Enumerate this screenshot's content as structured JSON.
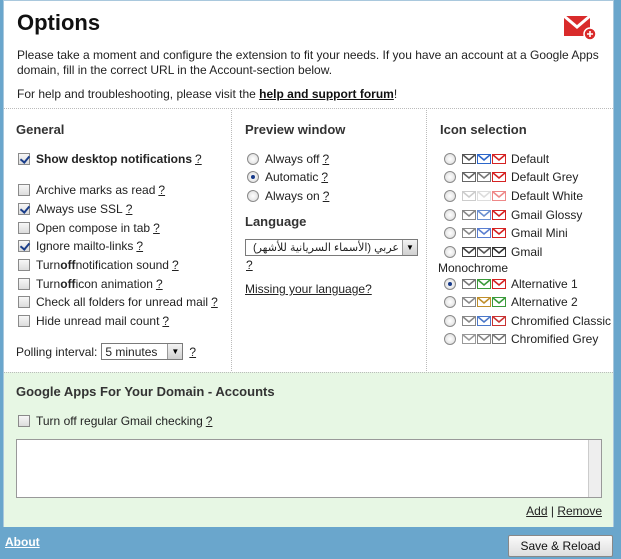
{
  "header": {
    "title": "Options",
    "intro": "Please take a moment and configure the extension to fit your needs. If you have an account at a Google Apps domain, fill in the correct URL in the Account-section below.",
    "help_prefix": "For help and troubleshooting, please visit the ",
    "help_link": "help and support forum",
    "help_suffix": "!"
  },
  "general": {
    "heading": "General",
    "options": [
      {
        "label": "Show desktop notifications",
        "checked": true,
        "bold": true
      },
      {
        "label": "Archive marks as read",
        "checked": false
      },
      {
        "label": "Always use SSL",
        "checked": true
      },
      {
        "label": "Open compose in tab",
        "checked": false
      },
      {
        "label": "Ignore mailto-links",
        "checked": true
      },
      {
        "label_pre": "Turn ",
        "label_bold": "off",
        "label_post": " notification sound",
        "checked": false
      },
      {
        "label_pre": "Turn ",
        "label_bold": "off",
        "label_post": " icon animation",
        "checked": false
      },
      {
        "label": "Check all folders for unread mail",
        "checked": false
      },
      {
        "label": "Hide unread mail count",
        "checked": false
      }
    ],
    "help_q": "?",
    "polling_label": "Polling interval:",
    "polling_value": "5 minutes"
  },
  "preview": {
    "heading": "Preview window",
    "options": [
      {
        "label": "Always off",
        "selected": false
      },
      {
        "label": "Automatic",
        "selected": true
      },
      {
        "label": "Always on",
        "selected": false
      }
    ],
    "language_heading": "Language",
    "language_value": "عربي (الأسماء السريانية للأشهر)",
    "missing_language": "Missing your language?"
  },
  "icons": {
    "heading": "Icon selection",
    "monochrome_label": "Monochrome",
    "options": [
      {
        "label": "Default",
        "selected": false
      },
      {
        "label": "Default Grey",
        "selected": false
      },
      {
        "label": "Default White",
        "selected": false
      },
      {
        "label": "Gmail Glossy",
        "selected": false
      },
      {
        "label": "Gmail Mini",
        "selected": false
      },
      {
        "label": "Gmail",
        "selected": false
      },
      {
        "label": "Alternative 1",
        "selected": true
      },
      {
        "label": "Alternative 2",
        "selected": false
      },
      {
        "label": "Chromified Classic",
        "selected": false
      },
      {
        "label": "Chromified Grey",
        "selected": false
      }
    ]
  },
  "gapps": {
    "heading": "Google Apps For Your Domain - Accounts",
    "checkbox_label": "Turn off regular Gmail checking",
    "add": "Add",
    "sep": "|",
    "remove": "Remove"
  },
  "footer": {
    "about": "About",
    "save": "Save & Reload"
  },
  "colors": {
    "background": "#6aa6cc",
    "gapps_bg": "#e7f7e4",
    "gmail_red": "#cc1d1d"
  }
}
